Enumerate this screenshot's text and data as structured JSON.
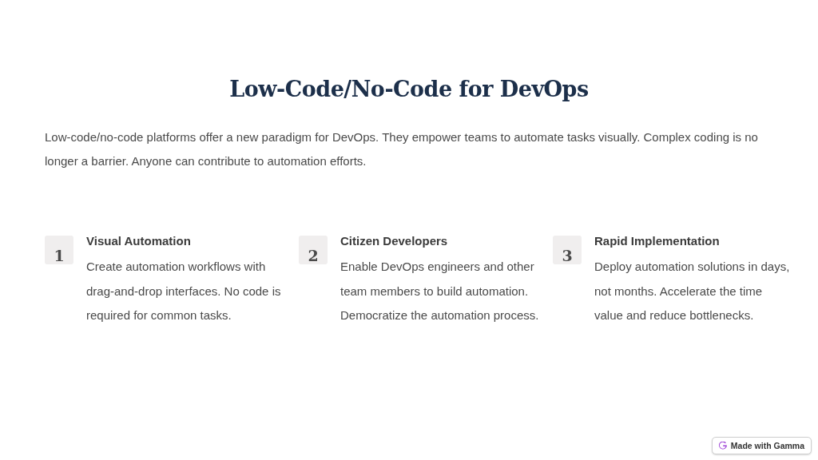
{
  "title": "Low-Code/No-Code for DevOps",
  "intro": "Low-code/no-code platforms offer a new paradigm for DevOps. They empower teams to automate tasks visually. Complex coding is no longer a barrier. Anyone can contribute to automation efforts.",
  "steps": [
    {
      "number": "1",
      "heading": "Visual Automation",
      "text": "Create automation workflows with drag-and-drop interfaces. No code is required for common tasks."
    },
    {
      "number": "2",
      "heading": "Citizen Developers",
      "text": "Enable DevOps engineers and other team members to build automation. Democratize the automation process."
    },
    {
      "number": "3",
      "heading": "Rapid Implementation",
      "text": "Deploy automation solutions in days, not months. Accelerate the time value and reduce bottlenecks."
    }
  ],
  "badge": "Made with Gamma"
}
